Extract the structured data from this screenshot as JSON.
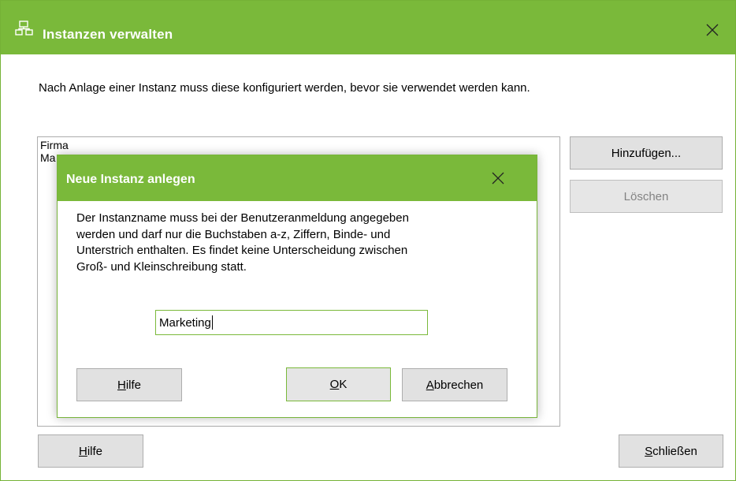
{
  "window": {
    "title": "Instanzen verwalten",
    "icon": "instances-icon",
    "close_icon": "close-icon",
    "description": "Nach Anlage einer Instanz muss diese konfiguriert werden, bevor sie verwendet werden kann.",
    "list_items": [
      "Firma",
      "Ma"
    ],
    "buttons": {
      "add": "Hinzufügen...",
      "delete": "Löschen",
      "help_mnemonic": "H",
      "help_rest": "ilfe",
      "close_mnemonic": "S",
      "close_rest": "chließen"
    }
  },
  "dialog": {
    "title": "Neue Instanz anlegen",
    "close_icon": "close-icon",
    "text_lines": [
      "Der Instanzname muss bei der Benutzeranmeldung angegeben",
      "werden und darf nur die Buchstaben a-z, Ziffern, Binde- und",
      "Unterstrich enthalten. Es findet keine Unterscheidung zwischen",
      "Groß- und Kleinschreibung statt."
    ],
    "input_value": "Marketing",
    "buttons": {
      "help_mnemonic": "H",
      "help_rest": "ilfe",
      "ok_mnemonic": "O",
      "ok_rest": "K",
      "cancel_mnemonic": "A",
      "cancel_rest": "bbrechen"
    }
  },
  "colors": {
    "accent": "#7ab93a",
    "button_face": "#e1e1e1",
    "button_border": "#adadad",
    "disabled_text": "#838383"
  }
}
